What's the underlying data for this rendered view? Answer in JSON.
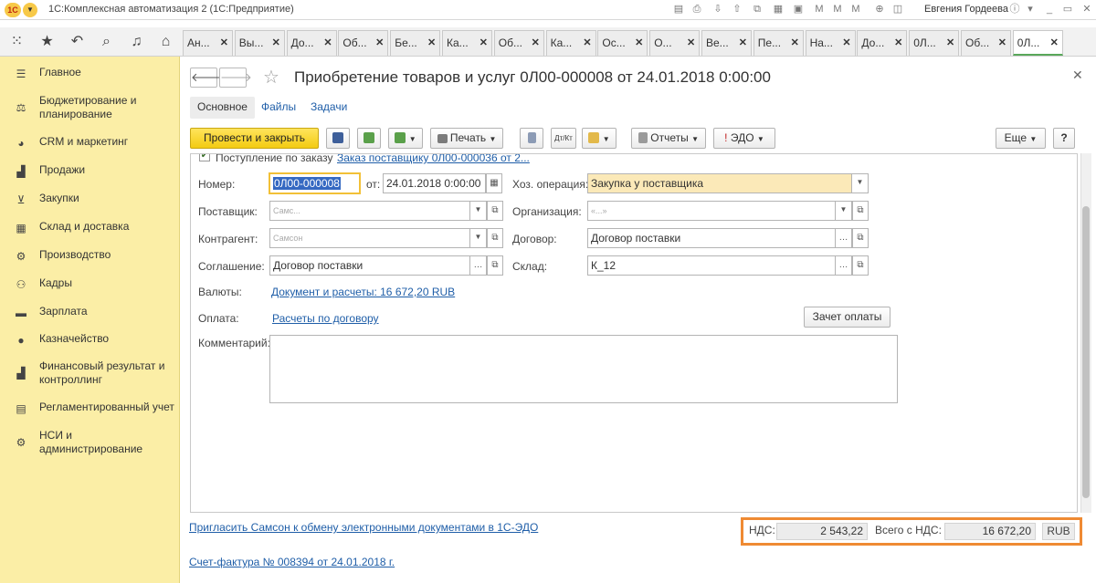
{
  "window": {
    "title": "1С:Комплексная автоматизация 2 (1С:Предприятие)",
    "user": "Евгения Гордеева",
    "logo_text": "1С"
  },
  "tabs": [
    {
      "label": "Ан..."
    },
    {
      "label": "Вы..."
    },
    {
      "label": "До..."
    },
    {
      "label": "Об..."
    },
    {
      "label": "Бе..."
    },
    {
      "label": "Ка..."
    },
    {
      "label": "Об..."
    },
    {
      "label": "Ка..."
    },
    {
      "label": "Ос..."
    },
    {
      "label": "О..."
    },
    {
      "label": "Ве..."
    },
    {
      "label": "Пе..."
    },
    {
      "label": "На..."
    },
    {
      "label": "До..."
    },
    {
      "label": "0Л..."
    },
    {
      "label": "Об..."
    },
    {
      "label": "0Л..."
    }
  ],
  "sidebar": {
    "items": [
      {
        "label": "Главное",
        "icon": "menu-icon"
      },
      {
        "label": "Бюджетирование и планирование",
        "icon": "budget-icon"
      },
      {
        "label": "CRM и маркетинг",
        "icon": "pie-icon"
      },
      {
        "label": "Продажи",
        "icon": "bag-icon"
      },
      {
        "label": "Закупки",
        "icon": "cart-icon"
      },
      {
        "label": "Склад и доставка",
        "icon": "warehouse-icon"
      },
      {
        "label": "Производство",
        "icon": "factory-icon"
      },
      {
        "label": "Кадры",
        "icon": "people-icon"
      },
      {
        "label": "Зарплата",
        "icon": "salary-icon"
      },
      {
        "label": "Казначейство",
        "icon": "coin-icon"
      },
      {
        "label": "Финансовый результат и контроллинг",
        "icon": "chart-icon"
      },
      {
        "label": "Регламентированный учет",
        "icon": "ledger-icon"
      },
      {
        "label": "НСИ и администрирование",
        "icon": "gear-icon"
      }
    ]
  },
  "document": {
    "title": "Приобретение товаров и услуг 0Л00-000008 от 24.01.2018 0:00:00",
    "sections": [
      "Основное",
      "Файлы",
      "Задачи"
    ]
  },
  "toolbar": {
    "post_close": "Провести и закрыть",
    "print": "Печать",
    "reports": "Отчеты",
    "edo": "ЭДО",
    "more": "Еще",
    "help": "?"
  },
  "form": {
    "order_checkbox_label": "Поступление по заказу",
    "order_link": "Заказ поставщику 0Л00-000036 от 2...",
    "number_label": "Номер:",
    "number_value": "0Л00-000008",
    "date_label": "от:",
    "date_value": "24.01.2018  0:00:00",
    "operation_label": "Хоз. операция:",
    "operation_value": "Закупка у поставщика",
    "supplier_label": "Поставщик:",
    "supplier_value": "Самс...",
    "organization_label": "Организация:",
    "organization_value": "«...»",
    "counterparty_label": "Контрагент:",
    "counterparty_value": "Самсон",
    "contract_label": "Договор:",
    "contract_value": "Договор поставки",
    "agreement_label": "Соглашение:",
    "agreement_value": "Договор поставки",
    "warehouse_label": "Склад:",
    "warehouse_value": "К_12",
    "currency_label": "Валюты:",
    "currency_link": "Документ и расчеты: 16 672,20 RUB",
    "payment_label": "Оплата:",
    "payment_link": "Расчеты по договору",
    "offset_button": "Зачет оплаты",
    "comment_label": "Комментарий:",
    "comment_value": ""
  },
  "footer": {
    "invite_link": "Пригласить Самсон к обмену электронными документами в 1С-ЭДО",
    "invoice_link": "Счет-фактура № 008394 от 24.01.2018 г.",
    "vat_label": "НДС:",
    "vat_value": "2 543,22",
    "total_label": "Всего с НДС:",
    "total_value": "16 672,20",
    "currency": "RUB"
  },
  "colors": {
    "sidebar_bg": "#fbeea6",
    "primary_button": "#f3cb12",
    "link": "#1f5ea8",
    "highlight_border": "#ef8a33",
    "active_tab_underline": "#59a85a"
  }
}
